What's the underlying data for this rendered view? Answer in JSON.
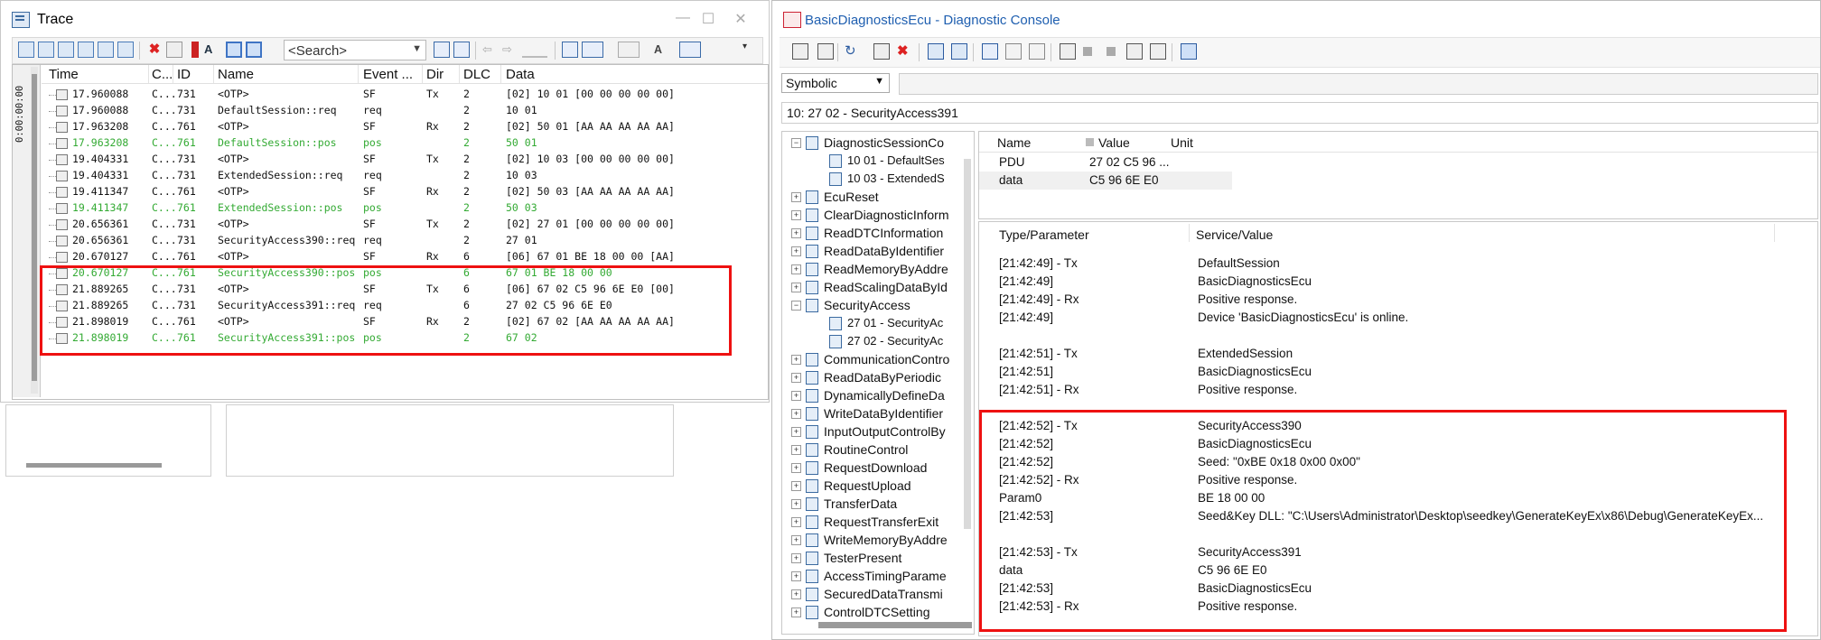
{
  "trace": {
    "title": "Trace",
    "search_placeholder": "<Search>",
    "time_axis_label": "0:00:00:00",
    "columns": [
      "Time",
      "C...",
      "ID",
      "Name",
      "Event ...",
      "Dir",
      "DLC",
      "Data"
    ],
    "rows": [
      {
        "time": "17.960088",
        "chn": "C...",
        "id": "731",
        "name": "<OTP>",
        "event": "SF",
        "dir": "Tx",
        "dlc": "2",
        "data": "[02] 10 01 [00 00 00 00 00]",
        "green": false
      },
      {
        "time": "17.960088",
        "chn": "C...",
        "id": "731",
        "name": "DefaultSession::req",
        "event": "req",
        "dir": "",
        "dlc": "2",
        "data": "10 01",
        "green": false
      },
      {
        "time": "17.963208",
        "chn": "C...",
        "id": "761",
        "name": "<OTP>",
        "event": "SF",
        "dir": "Rx",
        "dlc": "2",
        "data": "[02] 50 01 [AA AA AA AA AA]",
        "green": false
      },
      {
        "time": "17.963208",
        "chn": "C...",
        "id": "761",
        "name": "DefaultSession::pos",
        "event": "pos",
        "dir": "",
        "dlc": "2",
        "data": "50 01",
        "green": true
      },
      {
        "time": "19.404331",
        "chn": "C...",
        "id": "731",
        "name": "<OTP>",
        "event": "SF",
        "dir": "Tx",
        "dlc": "2",
        "data": "[02] 10 03 [00 00 00 00 00]",
        "green": false
      },
      {
        "time": "19.404331",
        "chn": "C...",
        "id": "731",
        "name": "ExtendedSession::req",
        "event": "req",
        "dir": "",
        "dlc": "2",
        "data": "10 03",
        "green": false
      },
      {
        "time": "19.411347",
        "chn": "C...",
        "id": "761",
        "name": "<OTP>",
        "event": "SF",
        "dir": "Rx",
        "dlc": "2",
        "data": "[02] 50 03 [AA AA AA AA AA]",
        "green": false
      },
      {
        "time": "19.411347",
        "chn": "C...",
        "id": "761",
        "name": "ExtendedSession::pos",
        "event": "pos",
        "dir": "",
        "dlc": "2",
        "data": "50 03",
        "green": true
      },
      {
        "time": "20.656361",
        "chn": "C...",
        "id": "731",
        "name": "<OTP>",
        "event": "SF",
        "dir": "Tx",
        "dlc": "2",
        "data": "[02] 27 01 [00 00 00 00 00]",
        "green": false
      },
      {
        "time": "20.656361",
        "chn": "C...",
        "id": "731",
        "name": "SecurityAccess390::req",
        "event": "req",
        "dir": "",
        "dlc": "2",
        "data": "27 01",
        "green": false
      },
      {
        "time": "20.670127",
        "chn": "C...",
        "id": "761",
        "name": "<OTP>",
        "event": "SF",
        "dir": "Rx",
        "dlc": "6",
        "data": "[06] 67 01 BE 18 00 00 [AA]",
        "green": false
      },
      {
        "time": "20.670127",
        "chn": "C...",
        "id": "761",
        "name": "SecurityAccess390::pos",
        "event": "pos",
        "dir": "",
        "dlc": "6",
        "data": "67 01 BE 18 00 00",
        "green": true
      },
      {
        "time": "21.889265",
        "chn": "C...",
        "id": "731",
        "name": "<OTP>",
        "event": "SF",
        "dir": "Tx",
        "dlc": "6",
        "data": "[06] 67 02 C5 96 6E E0 [00]",
        "green": false
      },
      {
        "time": "21.889265",
        "chn": "C...",
        "id": "731",
        "name": "SecurityAccess391::req",
        "event": "req",
        "dir": "",
        "dlc": "6",
        "data": "27 02 C5 96 6E E0",
        "green": false
      },
      {
        "time": "21.898019",
        "chn": "C...",
        "id": "761",
        "name": "<OTP>",
        "event": "SF",
        "dir": "Rx",
        "dlc": "2",
        "data": "[02] 67 02 [AA AA AA AA AA]",
        "green": false
      },
      {
        "time": "21.898019",
        "chn": "C...",
        "id": "761",
        "name": "SecurityAccess391::pos",
        "event": "pos",
        "dir": "",
        "dlc": "2",
        "data": "67 02",
        "green": true
      }
    ]
  },
  "diag": {
    "title": "BasicDiagnosticsEcu - Diagnostic Console",
    "mode_select": "Symbolic",
    "request_path": "10: 27 02 - SecurityAccess391",
    "tree": [
      {
        "label": "DiagnosticSessionCo",
        "pm": "−",
        "level": 0
      },
      {
        "label": "10 01 - DefaultSes",
        "level": 1
      },
      {
        "label": "10 03 - ExtendedS",
        "level": 1
      },
      {
        "label": "EcuReset",
        "pm": "+",
        "level": 0
      },
      {
        "label": "ClearDiagnosticInform",
        "pm": "+",
        "level": 0
      },
      {
        "label": "ReadDTCInformation",
        "pm": "+",
        "level": 0
      },
      {
        "label": "ReadDataByIdentifier",
        "pm": "+",
        "level": 0
      },
      {
        "label": "ReadMemoryByAddre",
        "pm": "+",
        "level": 0
      },
      {
        "label": "ReadScalingDataById",
        "pm": "+",
        "level": 0
      },
      {
        "label": "SecurityAccess",
        "pm": "−",
        "level": 0
      },
      {
        "label": "27 01 - SecurityAc",
        "level": 1
      },
      {
        "label": "27 02 - SecurityAc",
        "level": 1
      },
      {
        "label": "CommunicationContro",
        "pm": "+",
        "level": 0
      },
      {
        "label": "ReadDataByPeriodic",
        "pm": "+",
        "level": 0
      },
      {
        "label": "DynamicallyDefineDa",
        "pm": "+",
        "level": 0
      },
      {
        "label": "WriteDataByIdentifier",
        "pm": "+",
        "level": 0
      },
      {
        "label": "InputOutputControlBy",
        "pm": "+",
        "level": 0
      },
      {
        "label": "RoutineControl",
        "pm": "+",
        "level": 0
      },
      {
        "label": "RequestDownload",
        "pm": "+",
        "level": 0
      },
      {
        "label": "RequestUpload",
        "pm": "+",
        "level": 0
      },
      {
        "label": "TransferData",
        "pm": "+",
        "level": 0
      },
      {
        "label": "RequestTransferExit",
        "pm": "+",
        "level": 0
      },
      {
        "label": "WriteMemoryByAddre",
        "pm": "+",
        "level": 0
      },
      {
        "label": "TesterPresent",
        "pm": "+",
        "level": 0
      },
      {
        "label": "AccessTimingParame",
        "pm": "+",
        "level": 0
      },
      {
        "label": "SecuredDataTransmi",
        "pm": "+",
        "level": 0
      },
      {
        "label": "ControlDTCSetting",
        "pm": "+",
        "level": 0
      }
    ],
    "param_headers": {
      "name": "Name",
      "value": "Value",
      "unit": "Unit"
    },
    "params": [
      {
        "name": "PDU",
        "value": "27 02 C5 96 ...",
        "unit": ""
      },
      {
        "name": "data",
        "value": "C5 96 6E E0",
        "unit": ""
      }
    ],
    "log_headers": {
      "type": "Type/Parameter",
      "service": "Service/Value"
    },
    "log": [
      {
        "a": "[21:42:49] - Tx",
        "b": "DefaultSession"
      },
      {
        "a": "[21:42:49]",
        "b": "BasicDiagnosticsEcu"
      },
      {
        "a": "[21:42:49] - Rx",
        "b": "Positive response."
      },
      {
        "a": "[21:42:49]",
        "b": "Device 'BasicDiagnosticsEcu' is online."
      },
      {
        "a": "",
        "b": ""
      },
      {
        "a": "[21:42:51] - Tx",
        "b": "ExtendedSession"
      },
      {
        "a": "[21:42:51]",
        "b": "BasicDiagnosticsEcu"
      },
      {
        "a": "[21:42:51] - Rx",
        "b": "Positive response."
      },
      {
        "a": "",
        "b": ""
      },
      {
        "a": "[21:42:52] - Tx",
        "b": "SecurityAccess390"
      },
      {
        "a": "[21:42:52]",
        "b": "BasicDiagnosticsEcu"
      },
      {
        "a": "[21:42:52]",
        "b": "Seed: \"0xBE 0x18 0x00 0x00\""
      },
      {
        "a": "[21:42:52] - Rx",
        "b": "Positive response."
      },
      {
        "a": "   Param0",
        "b": "   BE 18 00 00"
      },
      {
        "a": "[21:42:53]",
        "b": "Seed&Key DLL: \"C:\\Users\\Administrator\\Desktop\\seedkey\\GenerateKeyEx\\x86\\Debug\\GenerateKeyEx..."
      },
      {
        "a": "",
        "b": ""
      },
      {
        "a": "[21:42:53] - Tx",
        "b": "SecurityAccess391"
      },
      {
        "a": "   data",
        "b": "   C5 96 6E E0"
      },
      {
        "a": "[21:42:53]",
        "b": "BasicDiagnosticsEcu"
      },
      {
        "a": "[21:42:53] - Rx",
        "b": "Positive response."
      }
    ]
  },
  "colors": {
    "highlight": "#ee1111",
    "green_text": "#33aa33",
    "title_blue": "#1f5fb0"
  }
}
